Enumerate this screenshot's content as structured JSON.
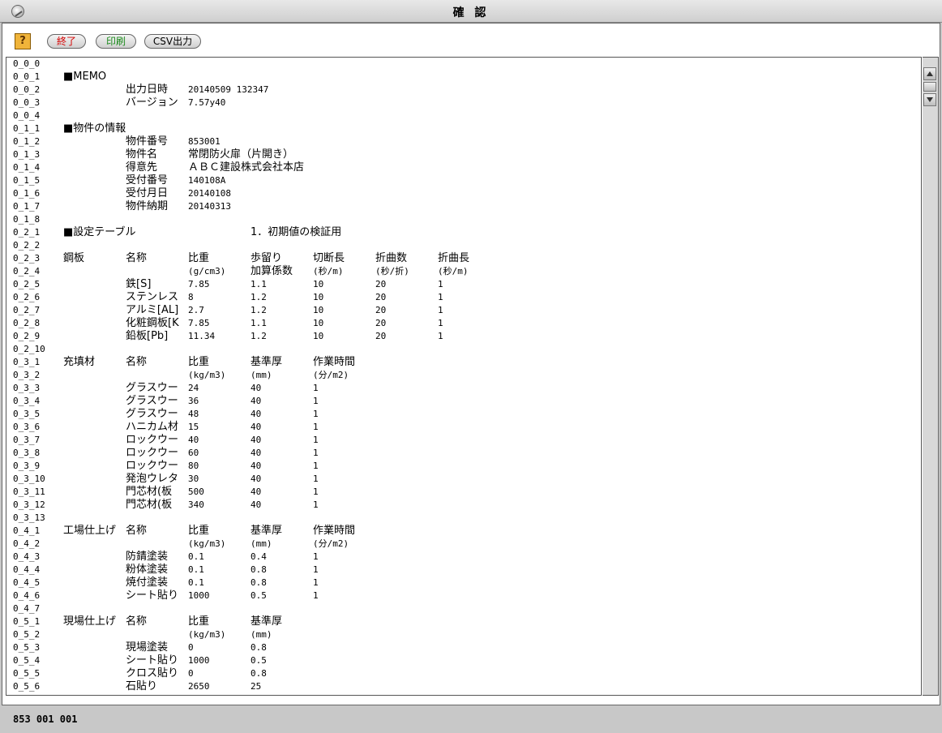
{
  "window": {
    "title": "確 認"
  },
  "toolbar": {
    "help_label": "?",
    "exit_label": "終了",
    "print_label": "印刷",
    "csv_label": "CSV出力"
  },
  "status": {
    "text": "853 001 001"
  },
  "lines": [
    {
      "id": "0_0_0",
      "cells": []
    },
    {
      "id": "0_0_1",
      "cells": [
        "■MEMO"
      ]
    },
    {
      "id": "0_0_2",
      "cells": [
        "",
        "出力日時",
        "20140509   132347"
      ]
    },
    {
      "id": "0_0_3",
      "cells": [
        "",
        "バージョン",
        "7.57y40"
      ]
    },
    {
      "id": "0_0_4",
      "cells": []
    },
    {
      "id": "0_1_1",
      "cells": [
        "■物件の情報"
      ]
    },
    {
      "id": "0_1_2",
      "cells": [
        "",
        "物件番号",
        "853001"
      ]
    },
    {
      "id": "0_1_3",
      "cells": [
        "",
        "物件名",
        "常閉防火扉（片開き）"
      ]
    },
    {
      "id": "0_1_4",
      "cells": [
        "",
        "得意先",
        "ＡＢＣ建設株式会社本店"
      ]
    },
    {
      "id": "0_1_5",
      "cells": [
        "",
        "受付番号",
        "140108A"
      ]
    },
    {
      "id": "0_1_6",
      "cells": [
        "",
        "受付月日",
        "20140108"
      ]
    },
    {
      "id": "0_1_7",
      "cells": [
        "",
        "物件納期",
        "20140313"
      ]
    },
    {
      "id": "0_1_8",
      "cells": []
    },
    {
      "id": "0_2_1",
      "cells": [
        "■設定テーブル",
        "",
        "",
        "1．初期値の検証用"
      ]
    },
    {
      "id": "0_2_2",
      "cells": []
    },
    {
      "id": "0_2_3",
      "cells": [
        "鋼板",
        "名称",
        "比重",
        "歩留り",
        "切断長",
        "折曲数",
        "折曲長"
      ]
    },
    {
      "id": "0_2_4",
      "cells": [
        "",
        "",
        "(g/cm3)",
        "加算係数",
        "(秒/m)",
        "(秒/折)",
        "(秒/m)"
      ]
    },
    {
      "id": "0_2_5",
      "cells": [
        "",
        "鉄[S]",
        "7.85",
        "1.1",
        "10",
        "20",
        "1"
      ]
    },
    {
      "id": "0_2_6",
      "cells": [
        "",
        "ステンレス",
        "8",
        "1.2",
        "10",
        "20",
        "1"
      ]
    },
    {
      "id": "0_2_7",
      "cells": [
        "",
        "アルミ[AL]",
        "2.7",
        "1.2",
        "10",
        "20",
        "1"
      ]
    },
    {
      "id": "0_2_8",
      "cells": [
        "",
        "化粧鋼板[K",
        "7.85",
        "1.1",
        "10",
        "20",
        "1"
      ]
    },
    {
      "id": "0_2_9",
      "cells": [
        "",
        "鉛板[Pb]",
        "11.34",
        "1.2",
        "10",
        "20",
        "1"
      ]
    },
    {
      "id": "0_2_10",
      "cells": []
    },
    {
      "id": "0_3_1",
      "cells": [
        "充填材",
        "名称",
        "比重",
        "基準厚",
        "作業時間"
      ]
    },
    {
      "id": "0_3_2",
      "cells": [
        "",
        "",
        "(kg/m3)",
        "(mm)",
        "(分/m2)"
      ]
    },
    {
      "id": "0_3_3",
      "cells": [
        "",
        "グラスウー",
        "24",
        "40",
        "1"
      ]
    },
    {
      "id": "0_3_4",
      "cells": [
        "",
        "グラスウー",
        "36",
        "40",
        "1"
      ]
    },
    {
      "id": "0_3_5",
      "cells": [
        "",
        "グラスウー",
        "48",
        "40",
        "1"
      ]
    },
    {
      "id": "0_3_6",
      "cells": [
        "",
        "ハニカム材",
        "15",
        "40",
        "1"
      ]
    },
    {
      "id": "0_3_7",
      "cells": [
        "",
        "ロックウー",
        "40",
        "40",
        "1"
      ]
    },
    {
      "id": "0_3_8",
      "cells": [
        "",
        "ロックウー",
        "60",
        "40",
        "1"
      ]
    },
    {
      "id": "0_3_9",
      "cells": [
        "",
        "ロックウー",
        "80",
        "40",
        "1"
      ]
    },
    {
      "id": "0_3_10",
      "cells": [
        "",
        "発泡ウレタ",
        "30",
        "40",
        "1"
      ]
    },
    {
      "id": "0_3_11",
      "cells": [
        "",
        "門芯材(板",
        "500",
        "40",
        "1"
      ]
    },
    {
      "id": "0_3_12",
      "cells": [
        "",
        "門芯材(板",
        "340",
        "40",
        "1"
      ]
    },
    {
      "id": "0_3_13",
      "cells": []
    },
    {
      "id": "0_4_1",
      "cells": [
        "工場仕上げ",
        "名称",
        "比重",
        "基準厚",
        "作業時間"
      ]
    },
    {
      "id": "0_4_2",
      "cells": [
        "",
        "",
        "(kg/m3)",
        "(mm)",
        "(分/m2)"
      ]
    },
    {
      "id": "0_4_3",
      "cells": [
        "",
        "防錆塗装",
        "0.1",
        "0.4",
        "1"
      ]
    },
    {
      "id": "0_4_4",
      "cells": [
        "",
        "粉体塗装",
        "0.1",
        "0.8",
        "1"
      ]
    },
    {
      "id": "0_4_5",
      "cells": [
        "",
        "焼付塗装",
        "0.1",
        "0.8",
        "1"
      ]
    },
    {
      "id": "0_4_6",
      "cells": [
        "",
        "シート貼り",
        "1000",
        "0.5",
        "1"
      ]
    },
    {
      "id": "0_4_7",
      "cells": []
    },
    {
      "id": "0_5_1",
      "cells": [
        "現場仕上げ",
        "名称",
        "比重",
        "基準厚"
      ]
    },
    {
      "id": "0_5_2",
      "cells": [
        "",
        "",
        "(kg/m3)",
        "(mm)"
      ]
    },
    {
      "id": "0_5_3",
      "cells": [
        "",
        "現場塗装",
        "0",
        "0.8"
      ]
    },
    {
      "id": "0_5_4",
      "cells": [
        "",
        "シート貼り",
        "1000",
        "0.5"
      ]
    },
    {
      "id": "0_5_5",
      "cells": [
        "",
        "クロス貼り",
        "0",
        "0.8"
      ]
    },
    {
      "id": "0_5_6",
      "cells": [
        "",
        "石貼り",
        "2650",
        "25"
      ]
    }
  ]
}
